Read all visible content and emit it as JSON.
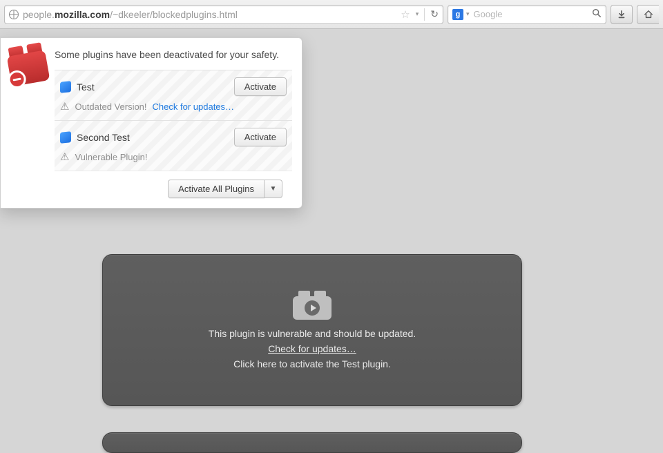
{
  "toolbar": {
    "url_prefix": "people.",
    "url_bold": "mozilla.com",
    "url_suffix": "/~dkeeler/blockedplugins.html",
    "search_engine_initial": "g",
    "search_placeholder": "Google"
  },
  "popup": {
    "title": "Some plugins have been deactivated for your safety.",
    "plugins": [
      {
        "name": "Test",
        "activate_label": "Activate",
        "status_text": "Outdated Version!",
        "update_link": "Check for updates…"
      },
      {
        "name": "Second Test",
        "activate_label": "Activate",
        "status_text": "Vulnerable Plugin!",
        "update_link": ""
      }
    ],
    "activate_all_label": "Activate All Plugins"
  },
  "placeholder": {
    "line1": "This plugin is vulnerable and should be updated.",
    "update_link": "Check for updates…",
    "line3": "Click here to activate the Test plugin."
  }
}
